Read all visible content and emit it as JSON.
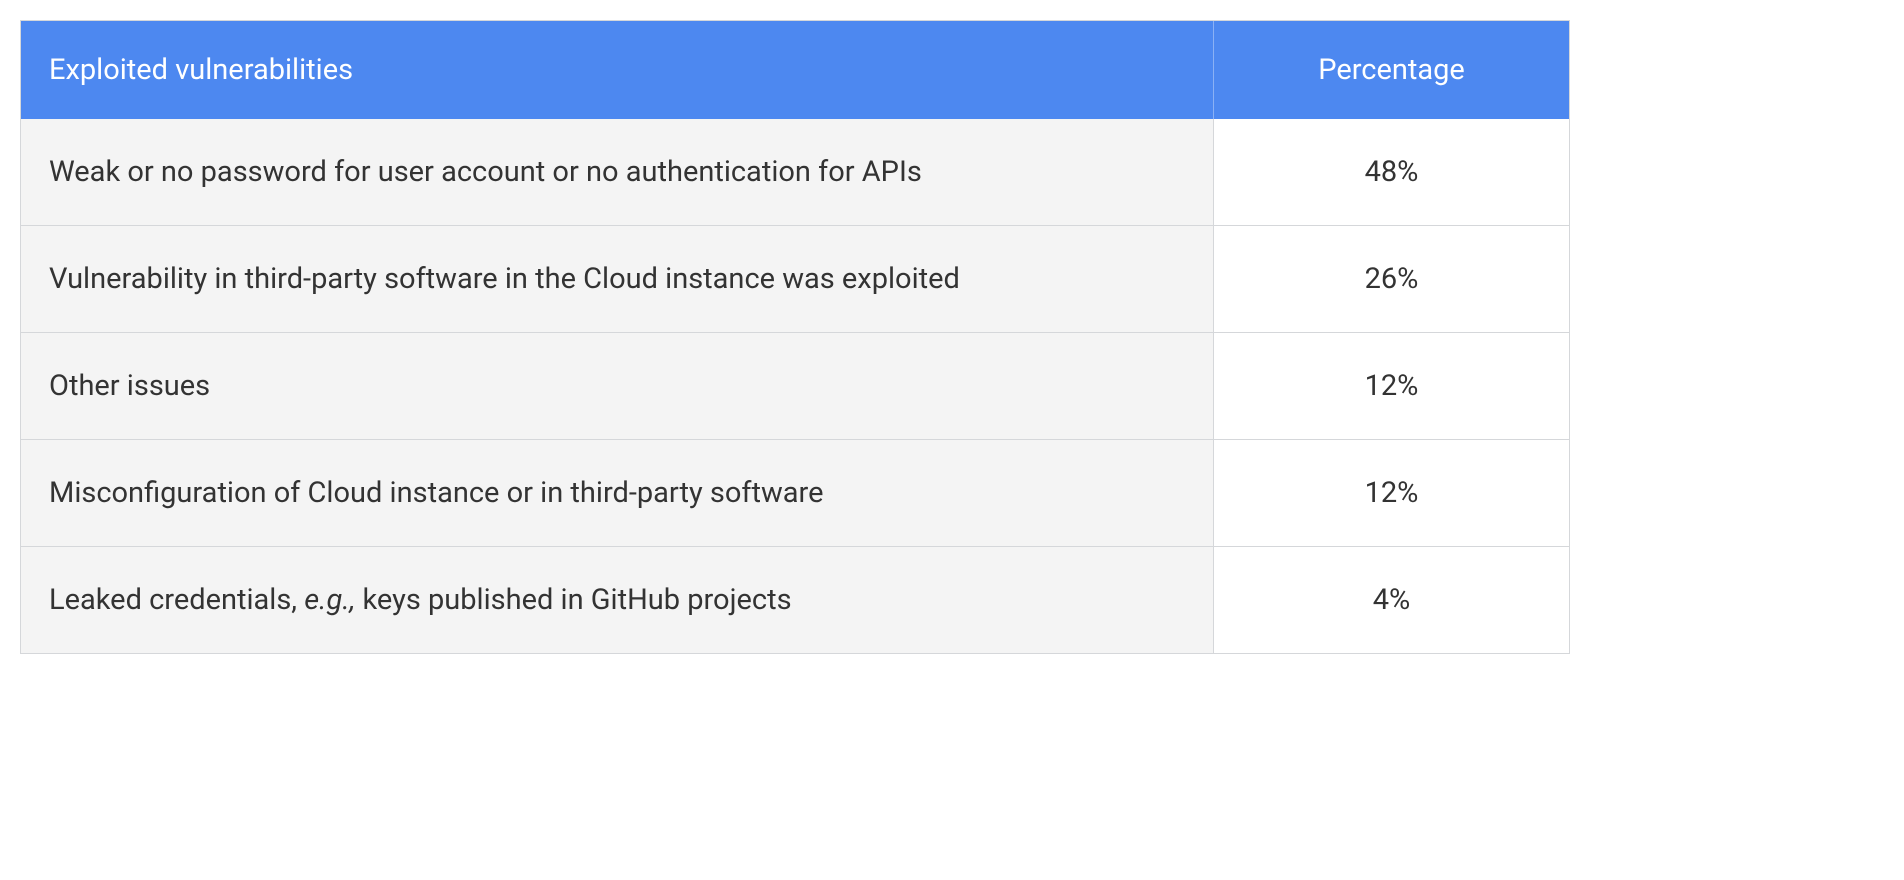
{
  "chart_data": {
    "type": "table",
    "columns": [
      "Exploited vulnerabilities",
      "Percentage"
    ],
    "rows": [
      [
        "Weak or no password for user account or no authentication for APIs",
        "48%"
      ],
      [
        "Vulnerability in third-party software in the Cloud instance was exploited",
        "26%"
      ],
      [
        "Other issues",
        "12%"
      ],
      [
        "Misconfiguration of Cloud instance or in third-party software",
        "12%"
      ],
      [
        "Leaked credentials, e.g., keys published in GitHub projects",
        "4%"
      ]
    ]
  },
  "table": {
    "headers": {
      "col1": "Exploited vulnerabilities",
      "col2": "Percentage"
    },
    "rows": [
      {
        "label_pre": "Weak or no password for user account or no authentication for APIs",
        "label_italic": "",
        "label_post": "",
        "value": "48%"
      },
      {
        "label_pre": "Vulnerability in third-party software in the Cloud instance was exploited",
        "label_italic": "",
        "label_post": "",
        "value": "26%"
      },
      {
        "label_pre": "Other issues",
        "label_italic": "",
        "label_post": "",
        "value": "12%"
      },
      {
        "label_pre": "Misconfiguration of Cloud instance or in third-party software",
        "label_italic": "",
        "label_post": "",
        "value": "12%"
      },
      {
        "label_pre": "Leaked credentials, ",
        "label_italic": "e.g.,",
        "label_post": " keys published in GitHub projects",
        "value": "4%"
      }
    ]
  }
}
